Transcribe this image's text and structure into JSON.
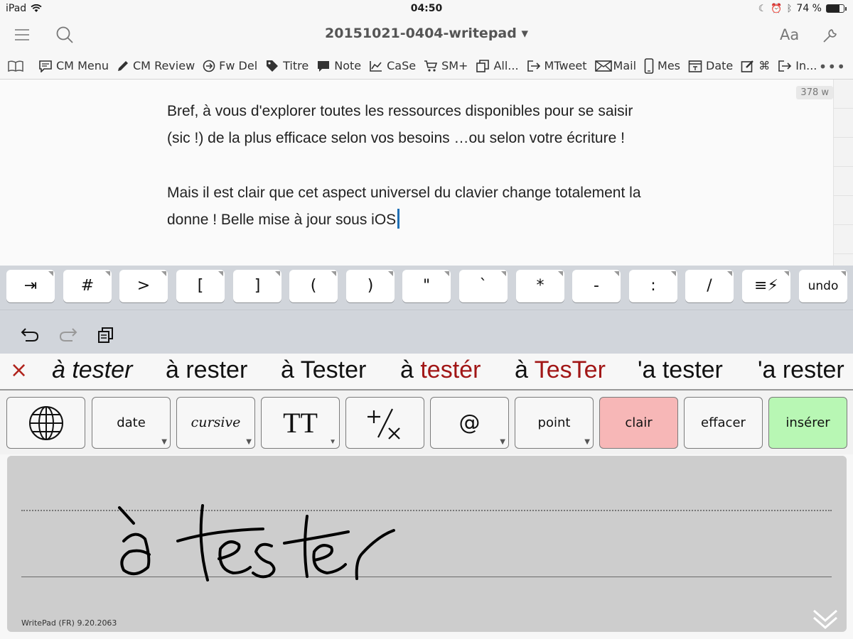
{
  "status_bar": {
    "device": "iPad",
    "time": "04:50",
    "battery_percent": "74 %",
    "battery_level": 0.74
  },
  "nav": {
    "title": "20151021-0404-writepad ▾",
    "font_button": "Aa"
  },
  "toolbar": {
    "items": [
      {
        "icon": "chat-icon",
        "label": "CM Menu"
      },
      {
        "icon": "pencil-icon",
        "label": "CM Review"
      },
      {
        "icon": "arrow-circle-icon",
        "label": "Fw Del"
      },
      {
        "icon": "tag-icon",
        "label": "Titre"
      },
      {
        "icon": "speech-bubble-icon",
        "label": "Note"
      },
      {
        "icon": "chart-icon",
        "label": "CaSe"
      },
      {
        "icon": "cart-icon",
        "label": "SM+"
      },
      {
        "icon": "copy-icon",
        "label": "All..."
      },
      {
        "icon": "share-icon",
        "label": "MTweet"
      },
      {
        "icon": "mail-icon",
        "label": "Mail"
      },
      {
        "icon": "phone-icon",
        "label": "Mes"
      },
      {
        "icon": "calendar-icon",
        "label": "Date"
      },
      {
        "icon": "edit-icon",
        "label": "⌘"
      },
      {
        "icon": "export-icon",
        "label": "In..."
      }
    ],
    "more": "•••"
  },
  "editor": {
    "word_count": "378 w",
    "paragraph1_line1": "Bref, à vous d'explorer toutes les ressources disponibles pour se saisir",
    "paragraph1_line2": "(sic !) de la plus efficace selon vos besoins …ou selon votre écriture !",
    "paragraph2_line1": "Mais il est clair que cet aspect universel du clavier change totalement la",
    "paragraph2_line2": "donne ! Belle mise à jour sous iOS"
  },
  "key_row": [
    "⇥",
    "#",
    ">",
    "[",
    "]",
    "(",
    ")",
    "\"",
    "`",
    "*",
    "-",
    ":",
    "/",
    "≡⚡",
    "undo"
  ],
  "suggestions": {
    "close": "×",
    "items": [
      {
        "pre": "à ",
        "word": "tester",
        "red": "",
        "italic": true
      },
      {
        "pre": "à rester",
        "word": "",
        "red": "",
        "italic": false
      },
      {
        "pre": "à Tester",
        "word": "",
        "red": "",
        "italic": false
      },
      {
        "pre": "à ",
        "word": "",
        "red": "testér",
        "italic": false
      },
      {
        "pre": "à ",
        "word": "",
        "red": "TesTer",
        "italic": false
      },
      {
        "pre": "'a tester",
        "word": "",
        "red": "",
        "italic": false
      },
      {
        "pre": "'a rester",
        "word": "",
        "red": "",
        "italic": false
      }
    ]
  },
  "pad_buttons": {
    "date": "date",
    "cursive": "cursive",
    "case": "TT",
    "at": "@",
    "point": "point",
    "clear": "clair",
    "erase": "effacer",
    "insert": "insérer"
  },
  "writing_area": {
    "version": "WritePad (FR) 9.20.2063",
    "handwriting": "à tester"
  },
  "colors": {
    "accent_blue": "#1f6fb5",
    "suggest_red": "#a11616",
    "clear_bg": "#f7b7b7",
    "insert_bg": "#b8f7b4"
  }
}
